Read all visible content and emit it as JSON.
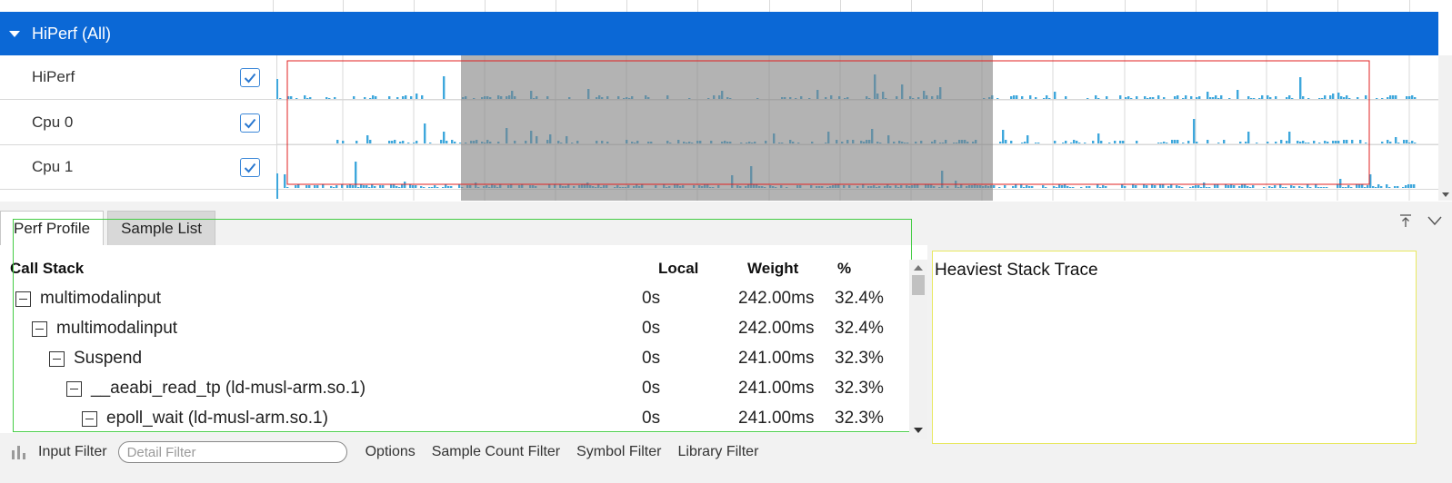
{
  "group": {
    "title": "HiPerf (All)"
  },
  "tracks": [
    {
      "label": "HiPerf",
      "checked": true
    },
    {
      "label": "Cpu 0",
      "checked": true
    },
    {
      "label": "Cpu 1",
      "checked": true
    }
  ],
  "colors": {
    "group_header": "#0b68d6",
    "bars": "#3ea7dc",
    "selection_overlay": "#808080",
    "red_outline": "#e02020",
    "green_outline": "#44cc44",
    "yellow_outline": "#e8e860"
  },
  "tabs": [
    {
      "label": "Perf Profile",
      "active": true
    },
    {
      "label": "Sample List",
      "active": false
    }
  ],
  "panel_tools": {
    "maximize_icon": "pin-top-icon",
    "collapse_icon": "chevron-down-icon"
  },
  "table": {
    "headers": {
      "call_stack": "Call Stack",
      "local": "Local",
      "weight": "Weight",
      "pct": "%"
    },
    "rows": [
      {
        "name": "multimodalinput",
        "local": "0s",
        "weight": "242.00ms",
        "pct": "32.4%"
      },
      {
        "name": "multimodalinput",
        "local": "0s",
        "weight": "242.00ms",
        "pct": "32.4%"
      },
      {
        "name": "Suspend",
        "local": "0s",
        "weight": "241.00ms",
        "pct": "32.3%"
      },
      {
        "name": "__aeabi_read_tp (ld-musl-arm.so.1)",
        "local": "0s",
        "weight": "241.00ms",
        "pct": "32.3%"
      },
      {
        "name": "epoll_wait (ld-musl-arm.so.1)",
        "local": "0s",
        "weight": "241.00ms",
        "pct": "32.3%"
      }
    ]
  },
  "heaviest": {
    "title": "Heaviest Stack Trace"
  },
  "filters": {
    "input_filter": "Input Filter",
    "detail_placeholder": "Detail Filter",
    "options": "Options",
    "sample_count": "Sample Count Filter",
    "symbol": "Symbol Filter",
    "library": "Library Filter"
  }
}
